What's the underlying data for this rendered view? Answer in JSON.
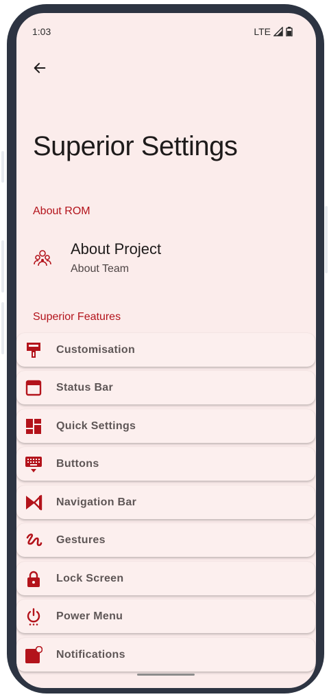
{
  "status_bar": {
    "time": "1:03",
    "network": "LTE"
  },
  "header": {
    "title": "Superior Settings"
  },
  "about_section": {
    "header": "About ROM",
    "item": {
      "title": "About Project",
      "subtitle": "About Team",
      "icon": "team-icon"
    }
  },
  "features_section": {
    "header": "Superior Features",
    "items": [
      {
        "label": "Customisation",
        "icon": "paint-brush-icon"
      },
      {
        "label": "Status Bar",
        "icon": "status-bar-icon"
      },
      {
        "label": "Quick Settings",
        "icon": "dashboard-icon"
      },
      {
        "label": "Buttons",
        "icon": "keyboard-icon"
      },
      {
        "label": "Navigation Bar",
        "icon": "navigation-icon"
      },
      {
        "label": "Gestures",
        "icon": "gesture-icon"
      },
      {
        "label": "Lock Screen",
        "icon": "lock-icon"
      },
      {
        "label": "Power Menu",
        "icon": "power-icon"
      },
      {
        "label": "Notifications",
        "icon": "notification-icon"
      }
    ]
  },
  "colors": {
    "accent": "#b3131b",
    "background": "#fbeceb",
    "frame": "#2d3442"
  }
}
